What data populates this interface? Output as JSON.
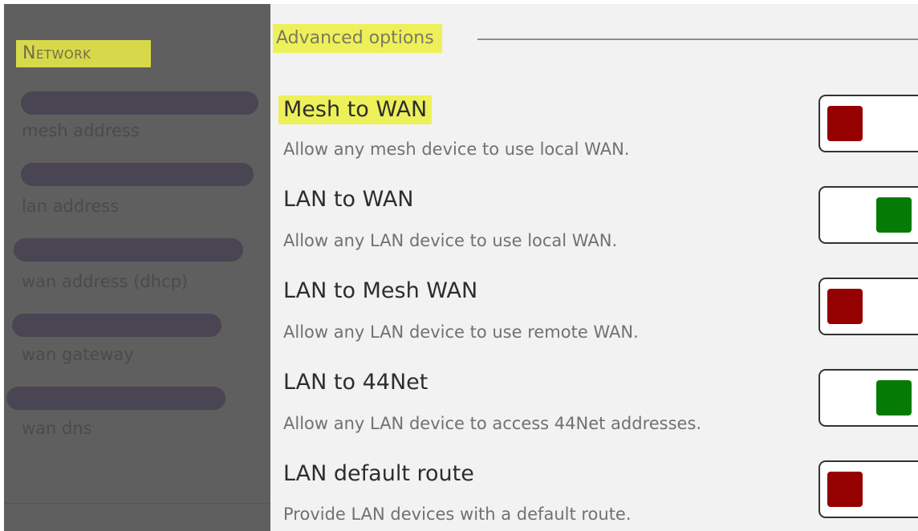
{
  "network_panel": {
    "section_title": "Network",
    "fields": [
      {
        "label": "mesh address"
      },
      {
        "label": "lan address"
      },
      {
        "label": "wan address (dhcp)"
      },
      {
        "label": "wan gateway"
      },
      {
        "label": "wan dns"
      }
    ],
    "redaction_color": "#4a4552"
  },
  "advanced_options": {
    "legend": "Advanced options",
    "options": [
      {
        "title": "Mesh to WAN",
        "description": "Allow any mesh device to use local WAN.",
        "state": "off"
      },
      {
        "title": "LAN to WAN",
        "description": "Allow any LAN device to use local WAN.",
        "state": "on"
      },
      {
        "title": "LAN to Mesh WAN",
        "description": "Allow any LAN device to use remote WAN.",
        "state": "off"
      },
      {
        "title": "LAN to 44Net",
        "description": "Allow any LAN device to access 44Net addresses.",
        "state": "on"
      },
      {
        "title": "LAN default route",
        "description": "Provide LAN devices with a default route.",
        "state": "off"
      }
    ]
  },
  "colors": {
    "highlight": "#eef05a",
    "toggle_off": "#950000",
    "toggle_on": "#057a05",
    "panel_bg": "#f2f2f2",
    "dim_panel_bg": "#5f5f5f"
  }
}
